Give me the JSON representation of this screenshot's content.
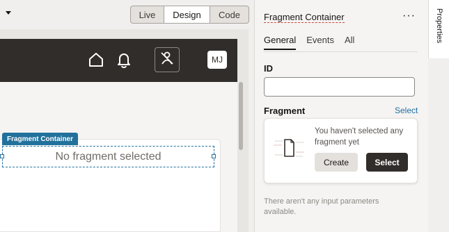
{
  "toolbar": {
    "modes": {
      "live": "Live",
      "design": "Design",
      "code": "Code"
    },
    "selected_mode": "Design"
  },
  "app_header": {
    "avatar_initials": "MJ"
  },
  "canvas": {
    "fragment_tag": "Fragment Container",
    "empty_message": "No fragment selected"
  },
  "panel": {
    "title": "Fragment Container",
    "more_label": "···",
    "tabs": [
      "General",
      "Events",
      "All"
    ],
    "active_tab": "General",
    "id_label": "ID",
    "id_value": "",
    "fragment_label": "Fragment",
    "select_link": "Select",
    "fragment_message": "You haven't selected any fragment yet",
    "create_button": "Create",
    "select_button": "Select",
    "no_params_message": "There aren't any input parameters available."
  },
  "side_tab": {
    "label": "Properties"
  },
  "colors": {
    "header_bg": "#312d2a",
    "accent_blue": "#22719c",
    "link_blue": "#1d6fa5",
    "primary_button": "#312d2a"
  }
}
